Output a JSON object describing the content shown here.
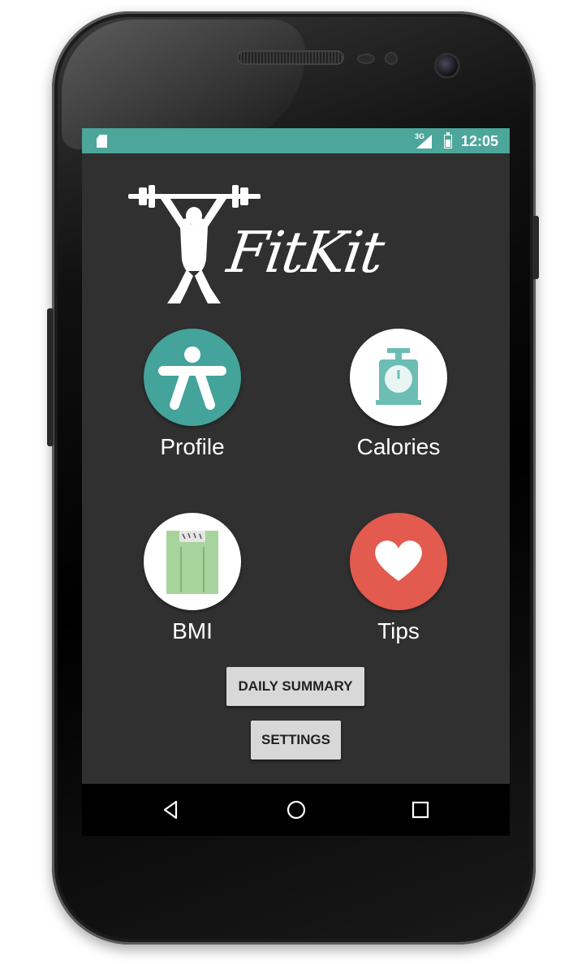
{
  "status_bar": {
    "network": "3G",
    "time": "12:05",
    "color": "#4ca69a"
  },
  "app": {
    "logo_text": "FitKit"
  },
  "tiles": [
    {
      "label": "Profile",
      "icon": "person-icon",
      "color": "#44a39b"
    },
    {
      "label": "Calories",
      "icon": "kitchen-scale-icon",
      "color": "#ffffff"
    },
    {
      "label": "BMI",
      "icon": "bathroom-scale-icon",
      "color": "#ffffff"
    },
    {
      "label": "Tips",
      "icon": "heart-icon",
      "color": "#e35a4e"
    }
  ],
  "buttons": {
    "daily_summary": "DAILY SUMMARY",
    "settings": "SETTINGS"
  },
  "nav": {
    "back": "back-icon",
    "home": "home-icon",
    "recents": "recents-icon"
  }
}
